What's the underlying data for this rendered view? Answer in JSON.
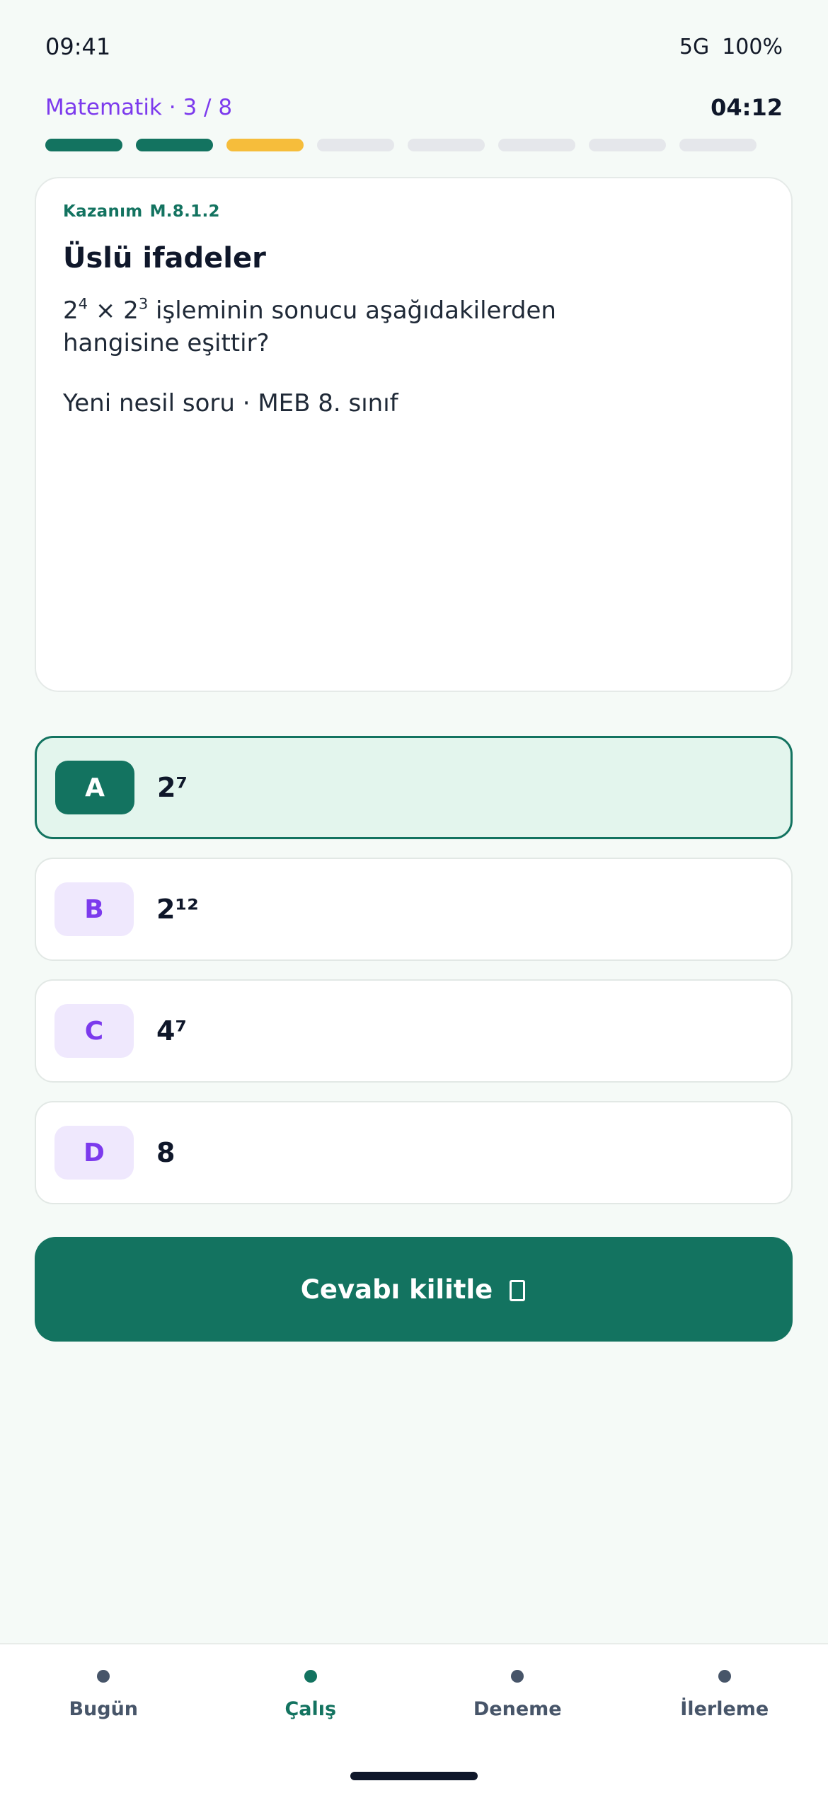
{
  "status_bar": {
    "time": "09:41",
    "network": "5G",
    "battery": "100%"
  },
  "quiz": {
    "subject_progress": "Matematik · 3 / 8",
    "timer": "04:12",
    "segments": [
      "done",
      "done",
      "current",
      "pending",
      "pending",
      "pending",
      "pending",
      "pending"
    ]
  },
  "question": {
    "outcome_label": "Kazanım",
    "outcome_code": "M.8.1.2",
    "title": "Üslü ifadeler",
    "line1_rest": " işleminin sonucu aşağıdakilerden",
    "line2": "hangisine eşittir?",
    "meta": "Yeni nesil soru · MEB 8. sınıf"
  },
  "options": [
    {
      "letter": "A",
      "value": "2⁷",
      "selected": true
    },
    {
      "letter": "B",
      "value": "2¹²",
      "selected": false
    },
    {
      "letter": "C",
      "value": "4⁷",
      "selected": false
    },
    {
      "letter": "D",
      "value": "8",
      "selected": false
    }
  ],
  "action": {
    "lock_label": "Cevabı kilitle",
    "icon": "lock-icon"
  },
  "bottom_nav": [
    {
      "label": "Bugün",
      "active": false
    },
    {
      "label": "Çalış",
      "active": true
    },
    {
      "label": "Deneme",
      "active": false
    },
    {
      "label": "İlerleme",
      "active": false
    }
  ],
  "colors": {
    "primary": "#137360",
    "accent": "#7c3aed",
    "current_segment": "#f6bd3b",
    "selected_bg": "#e3f5ed"
  }
}
